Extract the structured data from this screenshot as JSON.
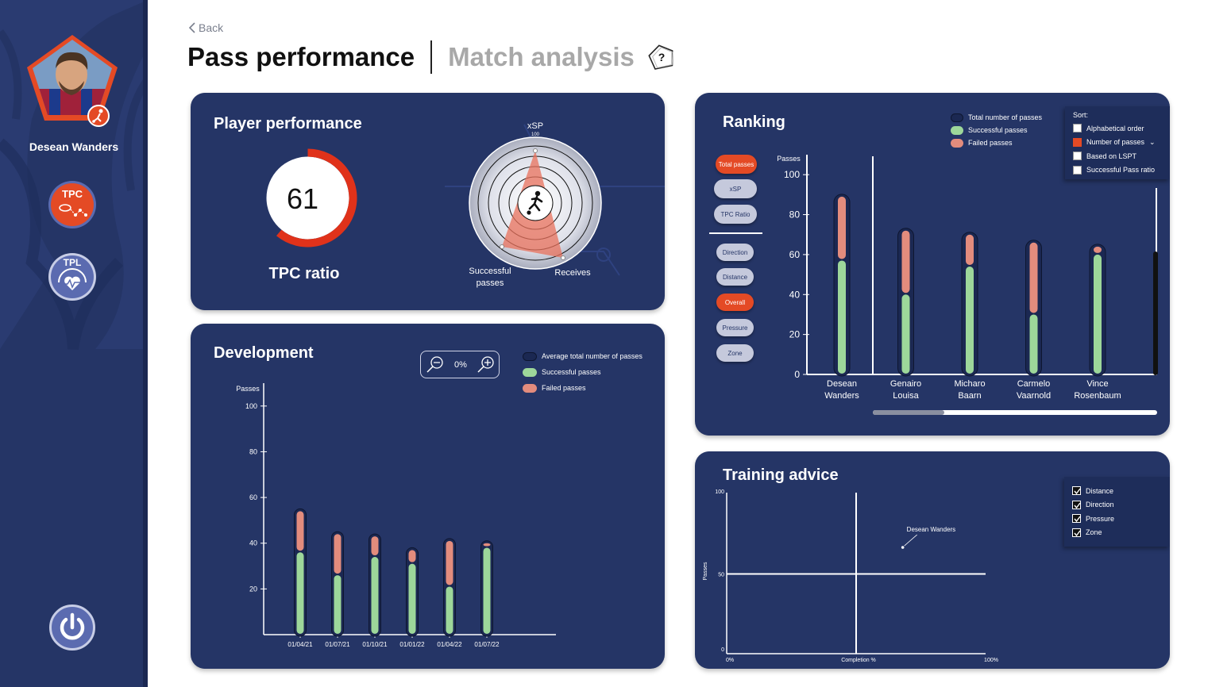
{
  "sidebar": {
    "player_name": "Desean Wanders",
    "nav": [
      {
        "label": "TPC",
        "icon": "pass-network-icon",
        "color": "#e44a25"
      },
      {
        "label": "TPL",
        "icon": "heart-rate-icon",
        "color": "#5b6bb0"
      }
    ]
  },
  "header": {
    "back_label": "Back",
    "title": "Pass performance",
    "subtitle": "Match analysis",
    "help_label": "?"
  },
  "player_performance": {
    "title": "Player performance",
    "tpc_value": "61",
    "tpc_fraction": 0.61,
    "tpc_label": "TPC ratio",
    "radar": {
      "axis_top": "xSP",
      "axis_top_scale": "100",
      "axis_left": [
        "Successful",
        "passes"
      ],
      "axis_right": "Receives"
    }
  },
  "development": {
    "title": "Development",
    "zoom_value": "0%",
    "legend": [
      "Average total number of passes",
      "Successful passes",
      "Failed passes"
    ]
  },
  "ranking": {
    "title": "Ranking",
    "legend": [
      "Total number of passes",
      "Successful passes",
      "Failed passes"
    ],
    "sort": {
      "label": "Sort:",
      "options": [
        {
          "label": "Alphabetical order",
          "checked": false
        },
        {
          "label": "Number of passes",
          "checked": true,
          "dropdown": "⌄"
        },
        {
          "label": "Based on LSPT",
          "checked": false
        },
        {
          "label": "Successful Pass ratio",
          "checked": false
        }
      ]
    },
    "metric_pills": [
      {
        "label": "Total passes",
        "active": true
      },
      {
        "label": "xSP",
        "active": false
      },
      {
        "label": "TPC Ratio",
        "active": false
      }
    ],
    "filter_pills": [
      {
        "label": "Direction",
        "active": false
      },
      {
        "label": "Distance",
        "active": false
      },
      {
        "label": "Overall",
        "active": true
      },
      {
        "label": "Pressure",
        "active": false
      },
      {
        "label": "Zone",
        "active": false
      }
    ],
    "scroll_fraction": 0.25
  },
  "training": {
    "title": "Training advice",
    "filters": [
      "Distance",
      "Direction",
      "Pressure",
      "Zone"
    ]
  },
  "colors": {
    "navy": "#253566",
    "accent": "#e44a25",
    "success": "#9dd79a",
    "failed": "#e38c7d"
  },
  "chart_data": [
    {
      "id": "development",
      "type": "bar",
      "stacked": true,
      "ylabel": "Passes",
      "yticks": [
        20,
        40,
        60,
        80,
        100
      ],
      "ylim": [
        0,
        110
      ],
      "categories": [
        "01/04/21",
        "01/07/21",
        "01/10/21",
        "01/01/22",
        "01/04/22",
        "01/07/22"
      ],
      "series": [
        {
          "name": "Successful passes",
          "values": [
            36,
            26,
            34,
            31,
            21,
            38
          ]
        },
        {
          "name": "Failed passes",
          "values": [
            18,
            18,
            9,
            6,
            20,
            2
          ]
        }
      ],
      "grid": false
    },
    {
      "id": "ranking",
      "type": "bar",
      "stacked": true,
      "ylabel": "Passes",
      "yticks": [
        0,
        20,
        40,
        60,
        80,
        100
      ],
      "ylim": [
        0,
        110
      ],
      "categories": [
        [
          "Desean",
          "Wanders"
        ],
        [
          "Genairo",
          "Louisa"
        ],
        [
          "Micharo",
          "Baarn"
        ],
        [
          "Carmelo",
          "Vaarnold"
        ],
        [
          "Vince",
          "Rosenbaum"
        ]
      ],
      "series": [
        {
          "name": "Successful passes",
          "values": [
            57,
            40,
            54,
            30,
            60
          ]
        },
        {
          "name": "Failed passes",
          "values": [
            32,
            32,
            16,
            36,
            4
          ]
        }
      ],
      "grid": false
    },
    {
      "id": "training",
      "type": "scatter",
      "xlabel": "Completion %",
      "ylabel": "Passes",
      "xtick_labels": [
        "0%",
        "100%"
      ],
      "ytick_labels": [
        "0",
        "50",
        "100"
      ],
      "xlim": [
        0,
        100
      ],
      "ylim": [
        0,
        100
      ],
      "points": [
        {
          "label": "Desean Wanders",
          "x": 68,
          "y": 66
        }
      ]
    }
  ]
}
